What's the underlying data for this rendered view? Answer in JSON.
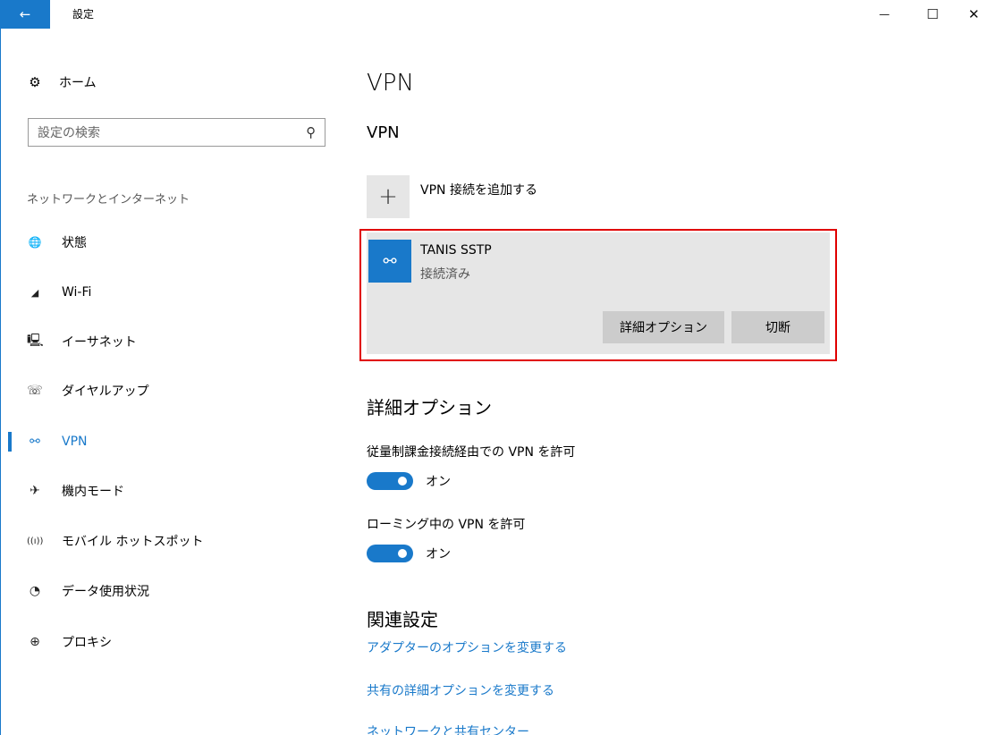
{
  "titlebar": {
    "back_icon": "←",
    "title": "設定",
    "minimize_icon": "—",
    "maximize_icon": "☐",
    "close_icon": "✕"
  },
  "sidebar": {
    "home_icon": "⚙",
    "home_label": "ホーム",
    "search_placeholder": "設定の検索",
    "search_icon": "⚲",
    "section_label": "ネットワークとインターネット",
    "items": [
      {
        "icon": "🌐",
        "label": "状態"
      },
      {
        "icon": "◢",
        "label": "Wi-Fi"
      },
      {
        "icon": "🖳",
        "label": "イーサネット"
      },
      {
        "icon": "☏",
        "label": "ダイヤルアップ"
      },
      {
        "icon": "⚯",
        "label": "VPN"
      },
      {
        "icon": "✈",
        "label": "機内モード"
      },
      {
        "icon": "((ı))",
        "label": "モバイル ホットスポット"
      },
      {
        "icon": "◔",
        "label": "データ使用状況"
      },
      {
        "icon": "⊕",
        "label": "プロキシ"
      }
    ],
    "selected_index": 4
  },
  "main": {
    "page_title": "VPN",
    "section_title": "VPN",
    "add_icon": "+",
    "add_label": "VPN 接続を追加する",
    "connection": {
      "icon": "⚯",
      "name": "TANIS SSTP",
      "status": "接続済み",
      "advanced_button": "詳細オプション",
      "disconnect_button": "切断"
    },
    "advanced_title": "詳細オプション",
    "settings": [
      {
        "label": "従量制課金接続経由での VPN を許可",
        "state": "オン",
        "on": true
      },
      {
        "label": "ローミング中の VPN を許可",
        "state": "オン",
        "on": true
      }
    ],
    "related_title": "関連設定",
    "links": [
      "アダプターのオプションを変更する",
      "共有の詳細オプションを変更する",
      "ネットワークと共有センター"
    ]
  },
  "colors": {
    "accent": "#1979ca",
    "highlight_border": "#e00000",
    "tile_bg": "#e6e6e6",
    "button_bg": "#cccccc"
  }
}
